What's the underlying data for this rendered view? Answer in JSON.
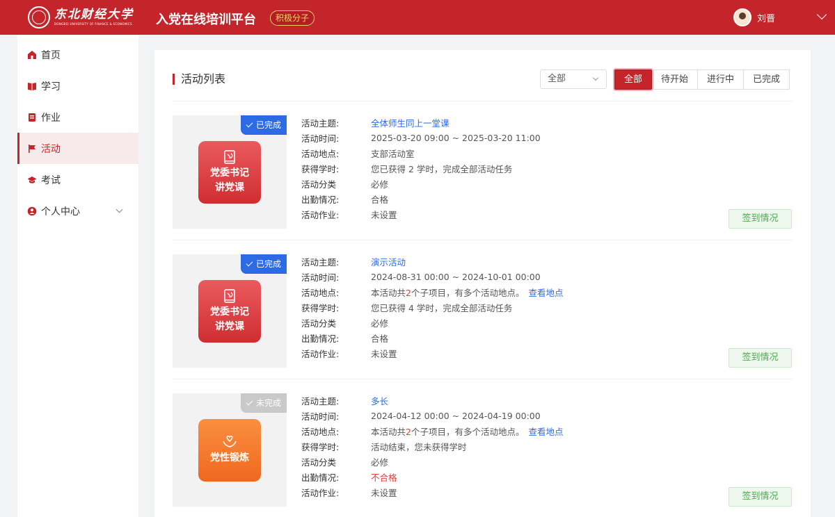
{
  "header": {
    "logo_cn": "东北财经大学",
    "logo_en": "DONGBEI UNIVERSITY OF FINANCE & ECONOMICS",
    "platform_title": "入党在线培训平台",
    "role_badge": "积极分子",
    "user_name": "刘晋"
  },
  "sidebar": {
    "items": [
      {
        "label": "首页",
        "icon": "home-icon"
      },
      {
        "label": "学习",
        "icon": "book-icon"
      },
      {
        "label": "作业",
        "icon": "notebook-icon"
      },
      {
        "label": "活动",
        "icon": "flag-icon",
        "active": true
      },
      {
        "label": "考试",
        "icon": "graduation-cap-icon"
      },
      {
        "label": "个人中心",
        "icon": "user-icon",
        "expandable": true
      }
    ]
  },
  "main": {
    "title": "活动列表",
    "select_value": "全部",
    "filters": [
      "全部",
      "待开始",
      "进行中",
      "已完成"
    ],
    "active_filter": "全部",
    "labels": {
      "topic": "活动主题:",
      "time": "活动时间:",
      "place": "活动地点:",
      "hours": "获得学时:",
      "category": "活动分类",
      "attendance": "出勤情况:",
      "homework": "活动作业:"
    },
    "sign_button": "签到情况",
    "activities": [
      {
        "status": "已完成",
        "badge_line1": "党委书记",
        "badge_line2": "讲党课",
        "topic": "全体师生同上一堂课",
        "time": "2025-03-20 09:00 ~ 2025-03-20 11:00",
        "place": "支部活动室",
        "hours": "您已获得 2 学时，完成全部活动任务",
        "category": "必修",
        "attendance": "合格",
        "homework": "未设置"
      },
      {
        "status": "已完成",
        "badge_line1": "党委书记",
        "badge_line2": "讲党课",
        "topic": "演示活动",
        "time": "2024-08-31 00:00 ~ 2024-10-01 00:00",
        "place_prefix": "本活动共",
        "place_count": "2",
        "place_suffix": "个子项目，有多个活动地点。",
        "place_link": "查看地点",
        "hours": "您已获得 4 学时，完成全部活动任务",
        "category": "必修",
        "attendance": "合格",
        "homework": "未设置"
      },
      {
        "status": "未完成",
        "badge_line1": "党性锻炼",
        "topic": "多长",
        "time": "2024-04-12 00:00 ~ 2024-04-19 00:00",
        "place_prefix": "本活动共",
        "place_count": "2",
        "place_suffix": "个子项目，有多个活动地点。",
        "place_link": "查看地点",
        "hours": "活动结束，您未获得学时",
        "category": "必修",
        "attendance": "不合格",
        "homework": "未设置"
      }
    ]
  },
  "colors": {
    "brand_red": "#c4252b",
    "status_done_blue": "#2d6be5",
    "status_undone_gray": "#c9c9c9",
    "sign_green": "#52a752",
    "fail_red": "#e23d3d"
  }
}
